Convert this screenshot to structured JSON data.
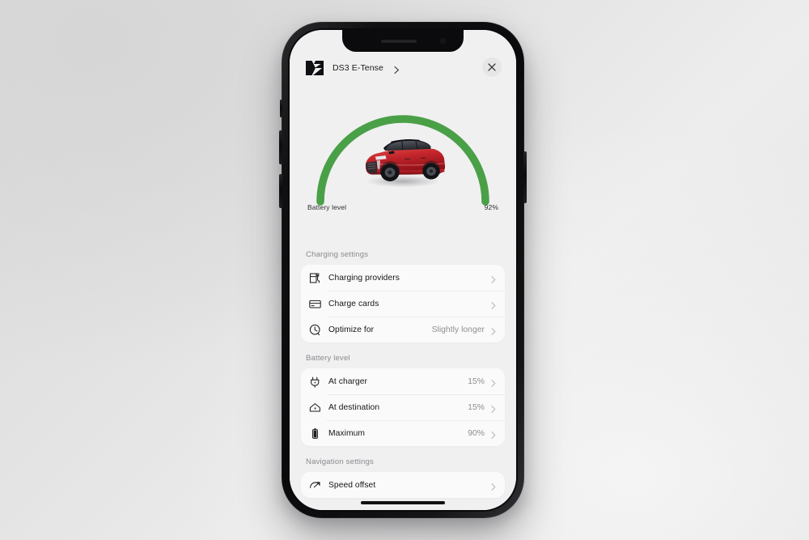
{
  "scene": {
    "background_top": "#d9d9d9",
    "background_bottom": "#ededed"
  },
  "phone": {
    "frame_color": "#101012",
    "screen_background": "#f0f0f1",
    "notch": "notch",
    "home_indicator": "home-indicator",
    "buttons": [
      "mute-switch",
      "volume-up",
      "volume-down",
      "power"
    ]
  },
  "header": {
    "brand_logo": "ds-logo-icon",
    "model": "DS3 E-Tense",
    "model_chevron": "chevron-right-icon",
    "close_label": "close-icon"
  },
  "gauge": {
    "label": "Battery level",
    "value_text": "92%",
    "percent": 92,
    "arc_color": "#4aa047",
    "track_color": "#f0f0f1",
    "vehicle": "red-ds3-crossover"
  },
  "sections": [
    {
      "title": "Charging settings",
      "rows": [
        {
          "icon": "charging-station-icon",
          "label": "Charging providers",
          "value": "",
          "chevron": true
        },
        {
          "icon": "credit-card-icon",
          "label": "Charge cards",
          "value": "",
          "chevron": true
        },
        {
          "icon": "clock-icon",
          "label": "Optimize for",
          "value": "Slightly longer",
          "chevron": true
        }
      ]
    },
    {
      "title": "Battery level",
      "rows": [
        {
          "icon": "plug-icon",
          "label": "At charger",
          "value": "15%",
          "chevron": true
        },
        {
          "icon": "home-bolt-icon",
          "label": "At destination",
          "value": "15%",
          "chevron": true
        },
        {
          "icon": "battery-full-icon",
          "label": "Maximum",
          "value": "90%",
          "chevron": true
        }
      ]
    },
    {
      "title": "Navigation settings",
      "rows": [
        {
          "icon": "speedometer-icon",
          "label": "Speed offset",
          "value": "",
          "chevron": true
        }
      ]
    }
  ],
  "colors": {
    "accent_green": "#4aa047",
    "text_primary": "#16161a",
    "text_secondary": "#8e8e93",
    "section_title": "#8b8b90",
    "card_bg": "#fafafa",
    "screen_bg": "#f0f0f1",
    "car_red": "#c1232b"
  }
}
